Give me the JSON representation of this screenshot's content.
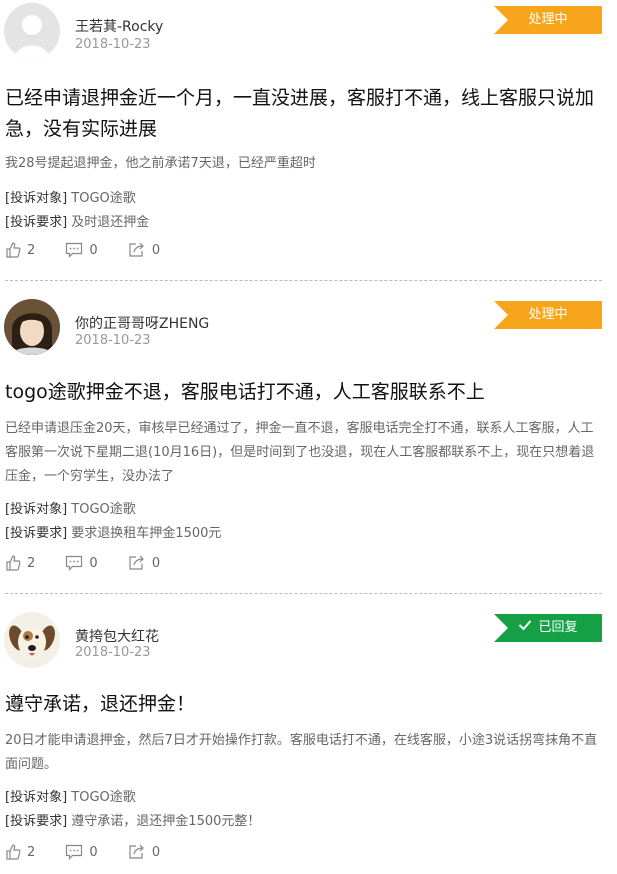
{
  "complaints": [
    {
      "user": "王若萁-Rocky",
      "date": "2018-10-23",
      "status": "处理中",
      "title": "已经申请退押金近一个月，一直没进展，客服打不通，线上客服只说加急，没有实际进展",
      "description": "我28号提起退押金，他之前承诺7天退，已经严重超时",
      "target_label": "[投诉对象]",
      "target": "TOGO途歌",
      "demand_label": "[投诉要求]",
      "demand": "及时退还押金",
      "likes": "2",
      "comments": "0",
      "shares": "0"
    },
    {
      "user": "你的正哥哥呀ZHENG",
      "date": "2018-10-23",
      "status": "处理中",
      "title": "togo途歌押金不退，客服电话打不通，人工客服联系不上",
      "description": "已经申请退压金20天，审核早已经通过了，押金一直不退，客服电话完全打不通，联系人工客服，人工客服第一次说下星期二退(10月16日)，但是时间到了也没退，现在人工客服都联系不上，现在只想着退压金，一个穷学生，没办法了",
      "target_label": "[投诉对象]",
      "target": "TOGO途歌",
      "demand_label": "[投诉要求]",
      "demand": "要求退换租车押金1500元",
      "likes": "2",
      "comments": "0",
      "shares": "0"
    },
    {
      "user": "黄挎包大红花",
      "date": "2018-10-23",
      "status": "已回复",
      "title": "遵守承诺，退还押金！",
      "description": "20日才能申请退押金，然后7日才开始操作打款。客服电话打不通，在线客服，小途3说话拐弯抹角不直面问题。",
      "target_label": "[投诉对象]",
      "target": "TOGO途歌",
      "demand_label": "[投诉要求]",
      "demand": "遵守承诺，退还押金1500元整！",
      "likes": "2",
      "comments": "0",
      "shares": "0"
    }
  ],
  "colors": {
    "processing": "#f7a51d",
    "replied": "#16a046"
  }
}
